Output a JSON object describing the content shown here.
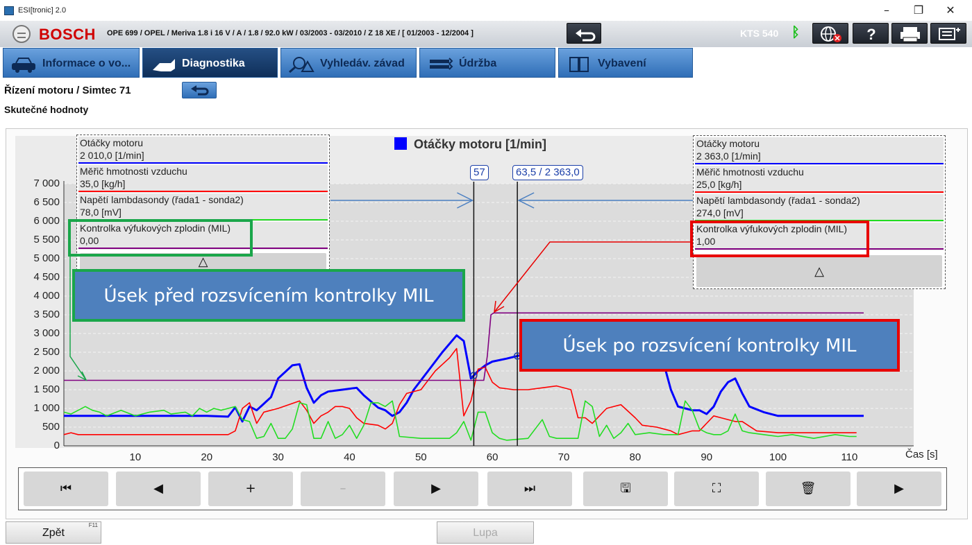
{
  "window": {
    "title": "ESI[tronic] 2.0",
    "minimize_glyph": "–",
    "maximize_glyph": "❐",
    "close_glyph": "✕"
  },
  "header": {
    "brand": "BOSCH",
    "vehicle": "OPE 699 / OPEL / Meriva 1.8 i 16 V / A / 1.8 / 92.0 kW / 03/2003 - 03/2010 / Z 18 XE / [ 01/2003 - 12/2004 ]",
    "device": "KTS 540",
    "icons": [
      "back-arrow-icon",
      "bluetooth-icon",
      "globe-offline-icon",
      "help-icon",
      "print-icon",
      "menu-icon"
    ]
  },
  "tabs": [
    {
      "label": "Informace o vo...",
      "icon": "car-info-icon",
      "active": false
    },
    {
      "label": "Diagnostika",
      "icon": "plug-icon",
      "active": true
    },
    {
      "label": "Vyhledáv. závad",
      "icon": "fault-search-icon",
      "active": false
    },
    {
      "label": "Údržba",
      "icon": "maintenance-icon",
      "active": false
    },
    {
      "label": "Vybavení",
      "icon": "equipment-book-icon",
      "active": false
    }
  ],
  "breadcrumb": "Řízení motoru / Simtec 71",
  "page_subtitle": "Skutečné hodnoty",
  "legend_left": [
    {
      "name": "Otáčky motoru",
      "value": "2 010,0 [1/min]",
      "color": "#0000ff"
    },
    {
      "name": "Měřič hmotnosti vzduchu",
      "value": "35,0 [kg/h]",
      "color": "#ff0000"
    },
    {
      "name": "Napětí lambdasondy (řada1 - sonda2)",
      "value": "78,0 [mV]",
      "color": "#22dd22"
    },
    {
      "name": "Kontrolka výfukových zplodin (MIL)",
      "value": "0,00",
      "color": "#800080"
    }
  ],
  "legend_right": [
    {
      "name": "Otáčky motoru",
      "value": "2 363,0 [1/min]",
      "color": "#0000ff"
    },
    {
      "name": "Měřič hmotnosti vzduchu",
      "value": "25,0 [kg/h]",
      "color": "#ff0000"
    },
    {
      "name": "Napětí lambdasondy (řada1 - sonda2)",
      "value": "274,0 [mV]",
      "color": "#22dd22"
    },
    {
      "name": "Kontrolka výfukových zplodin (MIL)",
      "value": "1,00",
      "color": "#800080"
    }
  ],
  "legend_scroll_glyph": "△",
  "cursor_labels": {
    "left": "57",
    "right": "63,5 / 2 363,0"
  },
  "callouts": {
    "before": "Úsek před rozsvícením kontrolky MIL",
    "after": "Úsek po rozsvícení kontrolky MIL",
    "before_border": "#1aa64a",
    "after_border": "#e80000"
  },
  "chart_data": {
    "type": "line",
    "title": "Otáčky motoru [1/min]",
    "xlabel": "Čas [s]",
    "ylabel": "",
    "xlim": [
      0,
      119
    ],
    "ylim": [
      0,
      7000
    ],
    "xticks": [
      10,
      20,
      30,
      40,
      50,
      60,
      70,
      80,
      90,
      100,
      110
    ],
    "yticks": [
      0,
      500,
      1000,
      1500,
      2000,
      2500,
      3000,
      3500,
      4000,
      4500,
      5000,
      5500,
      6000,
      6500,
      7000
    ],
    "ytick_labels": [
      "0",
      "500",
      "1 000",
      "1 500",
      "2 000",
      "2 500",
      "3 000",
      "3 500",
      "4 000",
      "4 500",
      "5 000",
      "5 500",
      "6 000",
      "6 500",
      "7 000"
    ],
    "grid": true,
    "cursors": [
      57.4,
      63.5
    ],
    "series": [
      {
        "name": "Otáčky motoru",
        "color": "#0000ff",
        "points": [
          [
            0,
            800
          ],
          [
            10,
            800
          ],
          [
            20,
            800
          ],
          [
            23,
            780
          ],
          [
            24,
            1030
          ],
          [
            25,
            650
          ],
          [
            26,
            1050
          ],
          [
            27,
            950
          ],
          [
            29,
            1300
          ],
          [
            30,
            1800
          ],
          [
            32,
            2150
          ],
          [
            33,
            2180
          ],
          [
            34,
            1550
          ],
          [
            35,
            1150
          ],
          [
            36,
            1350
          ],
          [
            37,
            1450
          ],
          [
            39,
            1500
          ],
          [
            41,
            1550
          ],
          [
            42,
            1350
          ],
          [
            44,
            1020
          ],
          [
            45,
            950
          ],
          [
            46,
            800
          ],
          [
            47,
            900
          ],
          [
            48,
            1150
          ],
          [
            49,
            1500
          ],
          [
            51,
            2000
          ],
          [
            53,
            2500
          ],
          [
            55,
            2950
          ],
          [
            56,
            2800
          ],
          [
            57,
            1800
          ],
          [
            58,
            2000
          ],
          [
            59,
            2150
          ],
          [
            60,
            2250
          ],
          [
            62,
            2330
          ],
          [
            63.5,
            2400
          ],
          [
            66,
            2500
          ],
          [
            70,
            2600
          ],
          [
            80,
            2700
          ],
          [
            83,
            2800
          ],
          [
            84,
            2200
          ],
          [
            85,
            1500
          ],
          [
            86,
            1050
          ],
          [
            87,
            1000
          ],
          [
            88,
            950
          ],
          [
            89,
            950
          ],
          [
            90,
            850
          ],
          [
            91,
            1050
          ],
          [
            92,
            1450
          ],
          [
            93,
            1700
          ],
          [
            94,
            1800
          ],
          [
            95,
            1400
          ],
          [
            96,
            1050
          ],
          [
            98,
            900
          ],
          [
            100,
            800
          ],
          [
            106,
            800
          ],
          [
            110,
            800
          ],
          [
            112,
            800
          ]
        ]
      },
      {
        "name": "Měřič hmotnosti vzduchu",
        "color": "#ff0000",
        "points": [
          [
            0,
            300
          ],
          [
            1,
            350
          ],
          [
            2,
            300
          ],
          [
            10,
            300
          ],
          [
            20,
            300
          ],
          [
            23,
            300
          ],
          [
            24,
            400
          ],
          [
            25,
            1000
          ],
          [
            26,
            1150
          ],
          [
            27,
            600
          ],
          [
            28,
            900
          ],
          [
            30,
            1000
          ],
          [
            33,
            1200
          ],
          [
            34,
            950
          ],
          [
            35,
            600
          ],
          [
            36,
            800
          ],
          [
            37,
            900
          ],
          [
            38,
            1050
          ],
          [
            39,
            1050
          ],
          [
            40,
            1000
          ],
          [
            41,
            750
          ],
          [
            42,
            600
          ],
          [
            44,
            550
          ],
          [
            45,
            450
          ],
          [
            46,
            600
          ],
          [
            47,
            1100
          ],
          [
            48,
            1400
          ],
          [
            50,
            1500
          ],
          [
            52,
            2000
          ],
          [
            54,
            2350
          ],
          [
            55,
            2600
          ],
          [
            56,
            800
          ],
          [
            57,
            1200
          ],
          [
            58,
            2050
          ],
          [
            59,
            2100
          ],
          [
            60,
            1700
          ],
          [
            61,
            1550
          ],
          [
            63,
            1500
          ],
          [
            65,
            1500
          ],
          [
            67,
            1550
          ],
          [
            69,
            1600
          ],
          [
            71,
            1500
          ],
          [
            72,
            750
          ],
          [
            73,
            750
          ],
          [
            74,
            600
          ],
          [
            76,
            1000
          ],
          [
            78,
            1100
          ],
          [
            80,
            750
          ],
          [
            81,
            550
          ],
          [
            83,
            500
          ],
          [
            84,
            450
          ],
          [
            85,
            400
          ],
          [
            86,
            300
          ],
          [
            87,
            350
          ],
          [
            88,
            400
          ],
          [
            89,
            400
          ],
          [
            91,
            800
          ],
          [
            92,
            750
          ],
          [
            94,
            650
          ],
          [
            95,
            650
          ],
          [
            97,
            400
          ],
          [
            100,
            350
          ],
          [
            105,
            350
          ],
          [
            110,
            350
          ],
          [
            111,
            350
          ]
        ]
      },
      {
        "name": "Napětí lambdasondy (řada1 - sonda2)",
        "color": "#22dd22",
        "points": [
          [
            0,
            900
          ],
          [
            1,
            850
          ],
          [
            3,
            1050
          ],
          [
            4,
            950
          ],
          [
            5,
            900
          ],
          [
            6,
            800
          ],
          [
            8,
            950
          ],
          [
            10,
            800
          ],
          [
            12,
            900
          ],
          [
            14,
            950
          ],
          [
            15,
            850
          ],
          [
            17,
            900
          ],
          [
            18,
            800
          ],
          [
            19,
            1000
          ],
          [
            20,
            900
          ],
          [
            21,
            1000
          ],
          [
            22,
            950
          ],
          [
            23,
            1000
          ],
          [
            24,
            1050
          ],
          [
            25,
            700
          ],
          [
            26,
            650
          ],
          [
            27,
            200
          ],
          [
            28,
            250
          ],
          [
            29,
            600
          ],
          [
            30,
            200
          ],
          [
            31,
            200
          ],
          [
            32,
            450
          ],
          [
            33,
            1150
          ],
          [
            34,
            1100
          ],
          [
            35,
            200
          ],
          [
            36,
            200
          ],
          [
            37,
            650
          ],
          [
            38,
            200
          ],
          [
            39,
            300
          ],
          [
            40,
            550
          ],
          [
            41,
            200
          ],
          [
            42,
            550
          ],
          [
            43,
            1150
          ],
          [
            44,
            1150
          ],
          [
            45,
            1050
          ],
          [
            46,
            1200
          ],
          [
            47,
            250
          ],
          [
            50,
            200
          ],
          [
            52,
            200
          ],
          [
            54,
            200
          ],
          [
            55,
            350
          ],
          [
            56,
            650
          ],
          [
            57,
            150
          ],
          [
            58,
            900
          ],
          [
            59,
            900
          ],
          [
            60,
            350
          ],
          [
            61,
            200
          ],
          [
            62,
            150
          ],
          [
            65,
            200
          ],
          [
            67,
            700
          ],
          [
            68,
            250
          ],
          [
            69,
            200
          ],
          [
            70,
            200
          ],
          [
            72,
            200
          ],
          [
            73,
            1200
          ],
          [
            74,
            1050
          ],
          [
            75,
            250
          ],
          [
            76,
            550
          ],
          [
            77,
            200
          ],
          [
            78,
            350
          ],
          [
            79,
            600
          ],
          [
            80,
            300
          ],
          [
            82,
            350
          ],
          [
            84,
            300
          ],
          [
            86,
            300
          ],
          [
            87,
            1200
          ],
          [
            88,
            950
          ],
          [
            89,
            450
          ],
          [
            90,
            350
          ],
          [
            91,
            300
          ],
          [
            92,
            300
          ],
          [
            93,
            400
          ],
          [
            94,
            850
          ],
          [
            95,
            400
          ],
          [
            96,
            350
          ],
          [
            98,
            300
          ],
          [
            100,
            250
          ],
          [
            102,
            300
          ],
          [
            105,
            200
          ],
          [
            108,
            300
          ],
          [
            110,
            250
          ],
          [
            111,
            250
          ]
        ]
      },
      {
        "name": "Kontrolka výfukových zplodin (MIL)",
        "color": "#800080",
        "points": [
          [
            0,
            1750
          ],
          [
            58.8,
            1750
          ],
          [
            59.3,
            2400
          ],
          [
            59.8,
            3500
          ],
          [
            60.2,
            3550
          ],
          [
            112,
            3550
          ]
        ]
      }
    ]
  },
  "toolbar": [
    {
      "name": "first-button",
      "glyph": "⏮",
      "disabled": false
    },
    {
      "name": "prev-button",
      "glyph": "◀",
      "disabled": false
    },
    {
      "name": "zoom-in-button",
      "glyph": "+",
      "disabled": false
    },
    {
      "name": "zoom-out-button",
      "glyph": "–",
      "disabled": true
    },
    {
      "name": "next-button",
      "glyph": "▶",
      "disabled": false
    },
    {
      "name": "last-button",
      "glyph": "⏭",
      "disabled": false
    },
    {
      "name": "save-button",
      "glyph": "🖫",
      "disabled": false
    },
    {
      "name": "graph-settings-button",
      "glyph": "⛶",
      "disabled": false
    },
    {
      "name": "delete-button",
      "glyph": "🗑",
      "disabled": false
    },
    {
      "name": "play-button",
      "glyph": "▶",
      "disabled": false
    }
  ],
  "footer": {
    "back_label": "Zpět",
    "back_key": "F11",
    "zoom_label": "Lupa"
  }
}
